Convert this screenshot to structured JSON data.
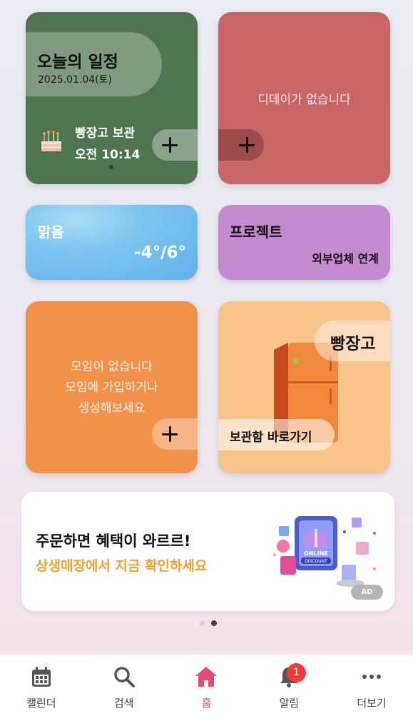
{
  "schedule": {
    "title": "오늘의 일정",
    "date": "2025.01.04(토)",
    "event_name": "빵장고 보관",
    "event_time": "오전 10:14",
    "event_icon": "cake-icon",
    "color": "#4f7450"
  },
  "dday": {
    "empty_text": "디데이가 없습니다",
    "color": "#c96566"
  },
  "weather": {
    "condition": "맑음",
    "temperature": "-4°/6°",
    "color": "#7cc4f0"
  },
  "project": {
    "title": "프로젝트",
    "subtitle": "외부업체 연계",
    "color": "#c48ad0"
  },
  "group": {
    "line1": "모임이 없습니다",
    "line2": "모임에 가입하거나",
    "line3": "생성해보세요",
    "color": "#f2924a"
  },
  "fridge": {
    "title": "빵장고",
    "go_label": "보관함 바로가기",
    "icon": "fridge-icon",
    "color": "#f9c48a"
  },
  "ad": {
    "line1": "주문하면 혜택이 와르르!",
    "line2": "상생매장에서 지금 확인하세요",
    "badge": "AD",
    "image_text_1": "ONLINE",
    "image_text_2": "DISCOUNT",
    "accent": "#f4a12b"
  },
  "pager": {
    "count": 2,
    "active": 2
  },
  "nav": {
    "items": [
      {
        "label": "캘린더",
        "icon": "calendar-icon"
      },
      {
        "label": "검색",
        "icon": "search-icon"
      },
      {
        "label": "홈",
        "icon": "home-icon"
      },
      {
        "label": "알림",
        "icon": "bell-icon"
      },
      {
        "label": "더보기",
        "icon": "more-icon"
      }
    ],
    "active": "홈",
    "notification_count": "1",
    "active_color": "#e64b74"
  }
}
